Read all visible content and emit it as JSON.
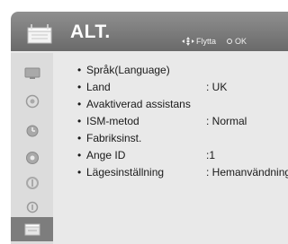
{
  "header": {
    "title": "ALT.",
    "hints": [
      {
        "icon": "move-arrows-icon",
        "label": "Flytta"
      },
      {
        "icon": "ok-dot-icon",
        "label": "OK"
      }
    ]
  },
  "sidebar": {
    "items": [
      {
        "icon": "picture-icon"
      },
      {
        "icon": "audio-icon"
      },
      {
        "icon": "time-icon"
      },
      {
        "icon": "lock-icon"
      },
      {
        "icon": "option-icon"
      },
      {
        "icon": "input-icon"
      },
      {
        "icon": "settings-icon",
        "selected": true
      }
    ]
  },
  "menu": {
    "bullet": "•",
    "items": [
      {
        "label": "Språk(Language)",
        "value": ""
      },
      {
        "label": "Land",
        "value": ": UK"
      },
      {
        "label": "Avaktiverad assistans",
        "value": ""
      },
      {
        "label": "ISM-metod",
        "value": ": Normal"
      },
      {
        "label": "Fabriksinst.",
        "value": ""
      },
      {
        "label": "Ange ID",
        "value": ":1"
      },
      {
        "label": "Lägesinställning",
        "value": ": Hemanvändning"
      }
    ]
  }
}
